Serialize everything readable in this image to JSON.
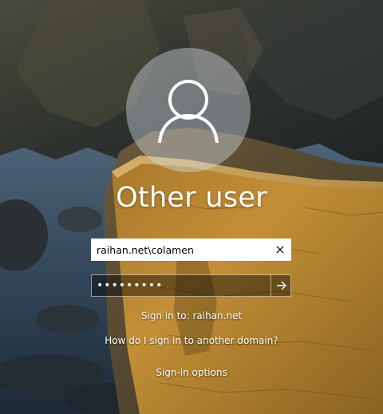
{
  "user": {
    "display_name": "Other user",
    "avatar_icon": "user-silhouette-icon"
  },
  "username_field": {
    "value": "raihan.net\\colamen",
    "clear_icon": "close-icon"
  },
  "password_field": {
    "value": "•••••••••",
    "submit_icon": "arrow-right-icon"
  },
  "links": {
    "sign_in_to": "Sign in to: raihan.net",
    "other_domain": "How do I sign in to another domain?",
    "sign_in_options": "Sign-in options"
  },
  "colors": {
    "text": "#ffffff",
    "avatar_bg": "rgba(215,222,230,0.42)"
  }
}
